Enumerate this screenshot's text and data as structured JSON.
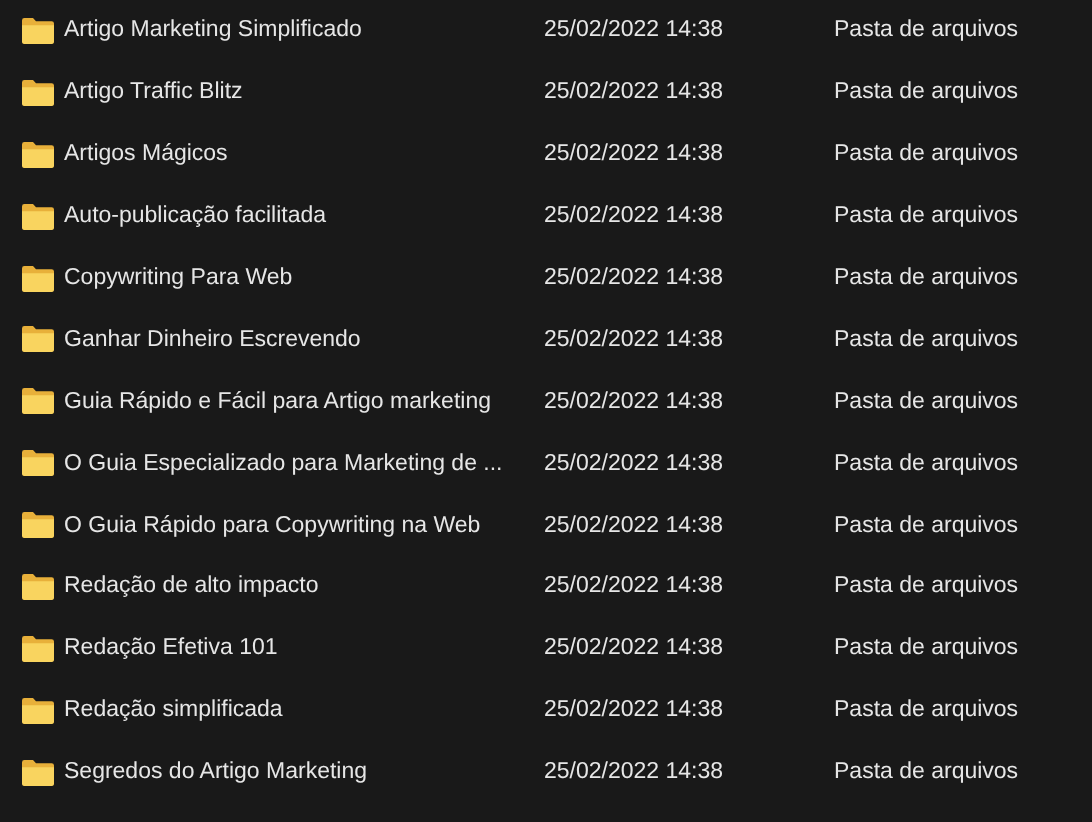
{
  "files": [
    {
      "name": "Artigo Marketing Simplificado",
      "date": "25/02/2022 14:38",
      "type": "Pasta de arquivos"
    },
    {
      "name": "Artigo Traffic Blitz",
      "date": "25/02/2022 14:38",
      "type": "Pasta de arquivos"
    },
    {
      "name": "Artigos Mágicos",
      "date": "25/02/2022 14:38",
      "type": "Pasta de arquivos"
    },
    {
      "name": "Auto-publicação facilitada",
      "date": "25/02/2022 14:38",
      "type": "Pasta de arquivos"
    },
    {
      "name": "Copywriting Para Web",
      "date": "25/02/2022 14:38",
      "type": "Pasta de arquivos"
    },
    {
      "name": "Ganhar Dinheiro Escrevendo",
      "date": "25/02/2022 14:38",
      "type": "Pasta de arquivos"
    },
    {
      "name": "Guia Rápido e Fácil para Artigo marketing",
      "date": "25/02/2022 14:38",
      "type": "Pasta de arquivos"
    },
    {
      "name": "O Guia Especializado para Marketing de ...",
      "date": "25/02/2022 14:38",
      "type": "Pasta de arquivos"
    },
    {
      "name": "O Guia Rápido para Copywriting na Web",
      "date": "25/02/2022 14:38",
      "type": "Pasta de arquivos"
    },
    {
      "name": "Redação de alto impacto",
      "date": "25/02/2022 14:38",
      "type": "Pasta de arquivos"
    },
    {
      "name": "Redação Efetiva 101",
      "date": "25/02/2022 14:38",
      "type": "Pasta de arquivos"
    },
    {
      "name": "Redação simplificada",
      "date": "25/02/2022 14:38",
      "type": "Pasta de arquivos"
    },
    {
      "name": "Segredos do Artigo Marketing",
      "date": "25/02/2022 14:38",
      "type": "Pasta de arquivos"
    }
  ]
}
